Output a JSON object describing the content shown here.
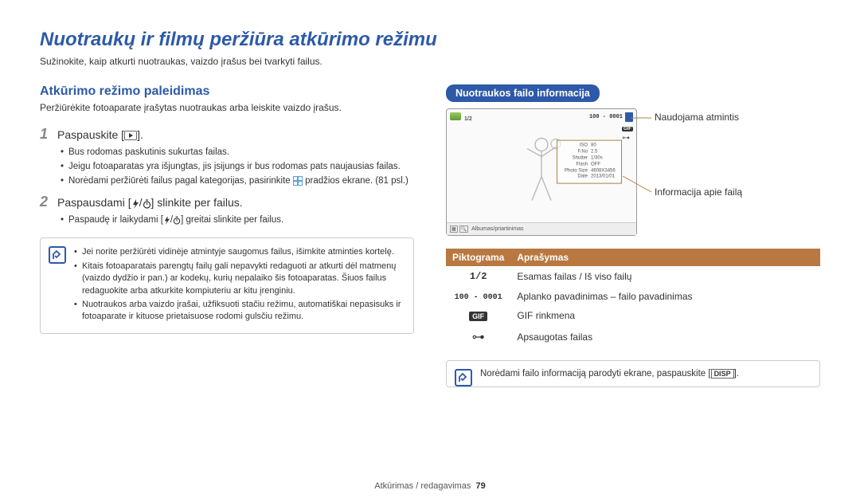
{
  "page": {
    "title": "Nuotraukų ir filmų peržiūra atkūrimo režimu",
    "subtitle": "Sužinokite, kaip atkurti nuotraukas, vaizdo įrašus bei tvarkyti failus.",
    "footer_section": "Atkūrimas / redagavimas",
    "footer_page": "79"
  },
  "left": {
    "heading": "Atkūrimo režimo paleidimas",
    "desc": "Peržiūrėkite fotoaparate įrašytas nuotraukas arba leiskite vaizdo įrašus.",
    "step1": {
      "num": "1",
      "pre": "Paspauskite [",
      "post": "].",
      "bullets": [
        "Bus rodomas paskutinis sukurtas failas.",
        "Jeigu fotoaparatas yra išjungtas, jis įsijungs ir bus rodomas pats naujausias failas.",
        "Norėdami peržiūrėti failus pagal kategorijas, pasirinkite ",
        " pradžios ekrane. (81 psl.)"
      ]
    },
    "step2": {
      "num": "2",
      "pre": "Paspausdami [",
      "mid": "/",
      "post": "] slinkite per failus.",
      "bullets_pre": "Paspaudę ir laikydami [",
      "bullets_mid": "/",
      "bullets_post": "] greitai slinkite per failus."
    },
    "note": {
      "items": [
        "Jei norite peržiūrėti vidinėje atmintyje saugomus failus, išimkite atminties kortelę.",
        "Kitais fotoaparatais parengtų failų gali nepavykti redaguoti ar atkurti dėl matmenų (vaizdo dydžio ir pan.) ar kodekų, kurių nepalaiko šis fotoaparatas. Šiuos failus redaguokite arba atkurkite kompiuteriu ar kitu įrenginiu.",
        "Nuotraukos arba vaizdo įrašai, užfiksuoti stačiu režimu, automatiškai nepasisuks ir fotoaparate ir kituose prietaisuose rodomi gulsčiu režimu."
      ]
    }
  },
  "right": {
    "badge": "Nuotraukos failo informacija",
    "screen": {
      "counter": "1/2",
      "file_id": "100 - 0001",
      "bottom_label": "Albumas/priartinimas",
      "info_rows": [
        {
          "k": "ISO",
          "v": "80"
        },
        {
          "k": "F.No",
          "v": "2.5"
        },
        {
          "k": "Shutter",
          "v": "1/30s"
        },
        {
          "k": "Flash",
          "v": "OFF"
        },
        {
          "k": "Photo Size",
          "v": "4608X3456"
        },
        {
          "k": "Date",
          "v": "2013/01/01"
        }
      ]
    },
    "callout_memory": "Naudojama atmintis",
    "callout_fileinfo": "Informacija apie failą",
    "table": {
      "h1": "Piktograma",
      "h2": "Aprašymas",
      "rows": [
        {
          "icon": "1/2",
          "desc": "Esamas failas / Iš viso failų"
        },
        {
          "icon": "100 - 0001",
          "desc": "Aplanko pavadinimas – failo pavadinimas"
        },
        {
          "icon": "GIF",
          "desc": "GIF rinkmena"
        },
        {
          "icon": "lock",
          "desc": "Apsaugotas failas"
        }
      ]
    },
    "bottom_note_pre": "Norėdami failo informaciją parodyti ekrane, paspauskite [",
    "bottom_note_btn": "DISP",
    "bottom_note_post": "]."
  }
}
